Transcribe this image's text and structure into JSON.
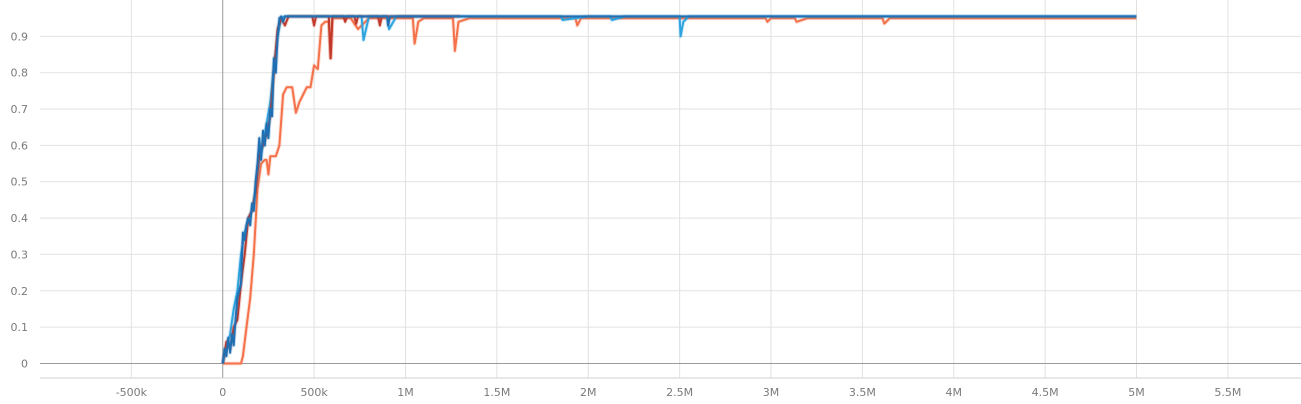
{
  "chart_data": {
    "type": "line",
    "title": "",
    "xlabel": "",
    "ylabel": "",
    "xlim": [
      -1000000,
      5900000
    ],
    "ylim": [
      -0.04,
      1.0
    ],
    "grid": true,
    "legend": "none",
    "x_ticks": [
      {
        "value": -500000,
        "label": "-500k"
      },
      {
        "value": 0,
        "label": "0"
      },
      {
        "value": 500000,
        "label": "500k"
      },
      {
        "value": 1000000,
        "label": "1M"
      },
      {
        "value": 1500000,
        "label": "1.5M"
      },
      {
        "value": 2000000,
        "label": "2M"
      },
      {
        "value": 2500000,
        "label": "2.5M"
      },
      {
        "value": 3000000,
        "label": "3M"
      },
      {
        "value": 3500000,
        "label": "3.5M"
      },
      {
        "value": 4000000,
        "label": "4M"
      },
      {
        "value": 4500000,
        "label": "4.5M"
      },
      {
        "value": 5000000,
        "label": "5M"
      },
      {
        "value": 5500000,
        "label": "5.5M"
      }
    ],
    "y_ticks": [
      {
        "value": 0,
        "label": "0"
      },
      {
        "value": 0.1,
        "label": "0.1"
      },
      {
        "value": 0.2,
        "label": "0.2"
      },
      {
        "value": 0.3,
        "label": "0.3"
      },
      {
        "value": 0.4,
        "label": "0.4"
      },
      {
        "value": 0.5,
        "label": "0.5"
      },
      {
        "value": 0.6,
        "label": "0.6"
      },
      {
        "value": 0.7,
        "label": "0.7"
      },
      {
        "value": 0.8,
        "label": "0.8"
      },
      {
        "value": 0.9,
        "label": "0.9"
      }
    ],
    "series": [
      {
        "color": "#f4714a",
        "x": [
          0,
          100000,
          110000,
          130000,
          150000,
          170000,
          190000,
          210000,
          230000,
          240000,
          250000,
          260000,
          270000,
          290000,
          310000,
          330000,
          350000,
          380000,
          400000,
          420000,
          440000,
          460000,
          480000,
          500000,
          520000,
          540000,
          560000,
          580000,
          590000,
          600000,
          650000,
          700000,
          740000,
          800000,
          850000,
          900000,
          1000000,
          1040000,
          1050000,
          1070000,
          1100000,
          1200000,
          1260000,
          1270000,
          1290000,
          1350000,
          1500000,
          1930000,
          1940000,
          1960000,
          2000000,
          2500000,
          2970000,
          2980000,
          3000000,
          3130000,
          3140000,
          3200000,
          3610000,
          3620000,
          3650000,
          4000000,
          4500000,
          5000000
        ],
        "y": [
          0.0,
          0.0,
          0.02,
          0.1,
          0.18,
          0.3,
          0.48,
          0.55,
          0.56,
          0.56,
          0.52,
          0.57,
          0.57,
          0.57,
          0.6,
          0.74,
          0.76,
          0.76,
          0.69,
          0.72,
          0.74,
          0.76,
          0.76,
          0.82,
          0.81,
          0.93,
          0.94,
          0.94,
          0.84,
          0.95,
          0.95,
          0.95,
          0.92,
          0.95,
          0.95,
          0.95,
          0.95,
          0.95,
          0.88,
          0.94,
          0.95,
          0.95,
          0.95,
          0.86,
          0.94,
          0.95,
          0.95,
          0.95,
          0.93,
          0.95,
          0.95,
          0.95,
          0.95,
          0.94,
          0.95,
          0.95,
          0.94,
          0.95,
          0.95,
          0.935,
          0.95,
          0.95,
          0.95,
          0.95
        ]
      },
      {
        "color": "#2da4e0",
        "x": [
          0,
          20000,
          40000,
          60000,
          80000,
          100000,
          120000,
          140000,
          160000,
          180000,
          200000,
          220000,
          240000,
          260000,
          280000,
          300000,
          320000,
          340000,
          400000,
          500000,
          700000,
          760000,
          770000,
          800000,
          900000,
          910000,
          950000,
          1000000,
          1500000,
          1850000,
          1860000,
          2000000,
          2120000,
          2130000,
          2200000,
          2500000,
          2505000,
          2520000,
          2550000,
          3000000,
          4000000,
          5000000
        ],
        "y": [
          0.0,
          0.05,
          0.08,
          0.15,
          0.2,
          0.3,
          0.36,
          0.4,
          0.42,
          0.48,
          0.56,
          0.6,
          0.66,
          0.72,
          0.82,
          0.9,
          0.95,
          0.955,
          0.955,
          0.955,
          0.955,
          0.955,
          0.89,
          0.955,
          0.955,
          0.92,
          0.955,
          0.955,
          0.955,
          0.955,
          0.945,
          0.955,
          0.955,
          0.945,
          0.955,
          0.955,
          0.9,
          0.94,
          0.955,
          0.955,
          0.955,
          0.955
        ]
      },
      {
        "color": "#c0392b",
        "x": [
          0,
          20000,
          40000,
          60000,
          80000,
          100000,
          120000,
          140000,
          160000,
          180000,
          200000,
          220000,
          240000,
          260000,
          280000,
          300000,
          320000,
          340000,
          360000,
          400000,
          490000,
          500000,
          510000,
          580000,
          590000,
          600000,
          660000,
          670000,
          680000,
          720000,
          730000,
          740000,
          850000,
          860000,
          870000,
          900000,
          1000000,
          1100000,
          1200000,
          1300000
        ],
        "y": [
          0.0,
          0.06,
          0.04,
          0.1,
          0.12,
          0.22,
          0.3,
          0.4,
          0.42,
          0.47,
          0.58,
          0.6,
          0.63,
          0.68,
          0.8,
          0.92,
          0.95,
          0.93,
          0.955,
          0.955,
          0.955,
          0.93,
          0.955,
          0.955,
          0.84,
          0.955,
          0.955,
          0.94,
          0.955,
          0.955,
          0.935,
          0.955,
          0.955,
          0.93,
          0.955,
          0.955,
          0.955,
          0.955,
          0.955,
          0.955
        ]
      },
      {
        "color": "#1f6fb2",
        "x": [
          0,
          10000,
          20000,
          30000,
          40000,
          50000,
          60000,
          70000,
          80000,
          90000,
          100000,
          110000,
          120000,
          130000,
          140000,
          150000,
          160000,
          170000,
          180000,
          190000,
          200000,
          210000,
          220000,
          230000,
          240000,
          250000,
          260000,
          270000,
          280000,
          290000,
          300000,
          310000,
          320000,
          330000,
          340000,
          400000,
          500000,
          800000,
          900000,
          905000,
          915000,
          1000000,
          1500000,
          2000000,
          3000000,
          4000000,
          5000000
        ],
        "y": [
          0.0,
          0.04,
          0.02,
          0.07,
          0.03,
          0.08,
          0.05,
          0.12,
          0.18,
          0.2,
          0.22,
          0.36,
          0.34,
          0.38,
          0.4,
          0.38,
          0.44,
          0.42,
          0.5,
          0.55,
          0.62,
          0.56,
          0.64,
          0.6,
          0.66,
          0.62,
          0.7,
          0.68,
          0.84,
          0.8,
          0.9,
          0.95,
          0.955,
          0.94,
          0.955,
          0.955,
          0.955,
          0.955,
          0.955,
          0.93,
          0.955,
          0.955,
          0.955,
          0.955,
          0.955,
          0.955,
          0.955
        ]
      }
    ]
  }
}
